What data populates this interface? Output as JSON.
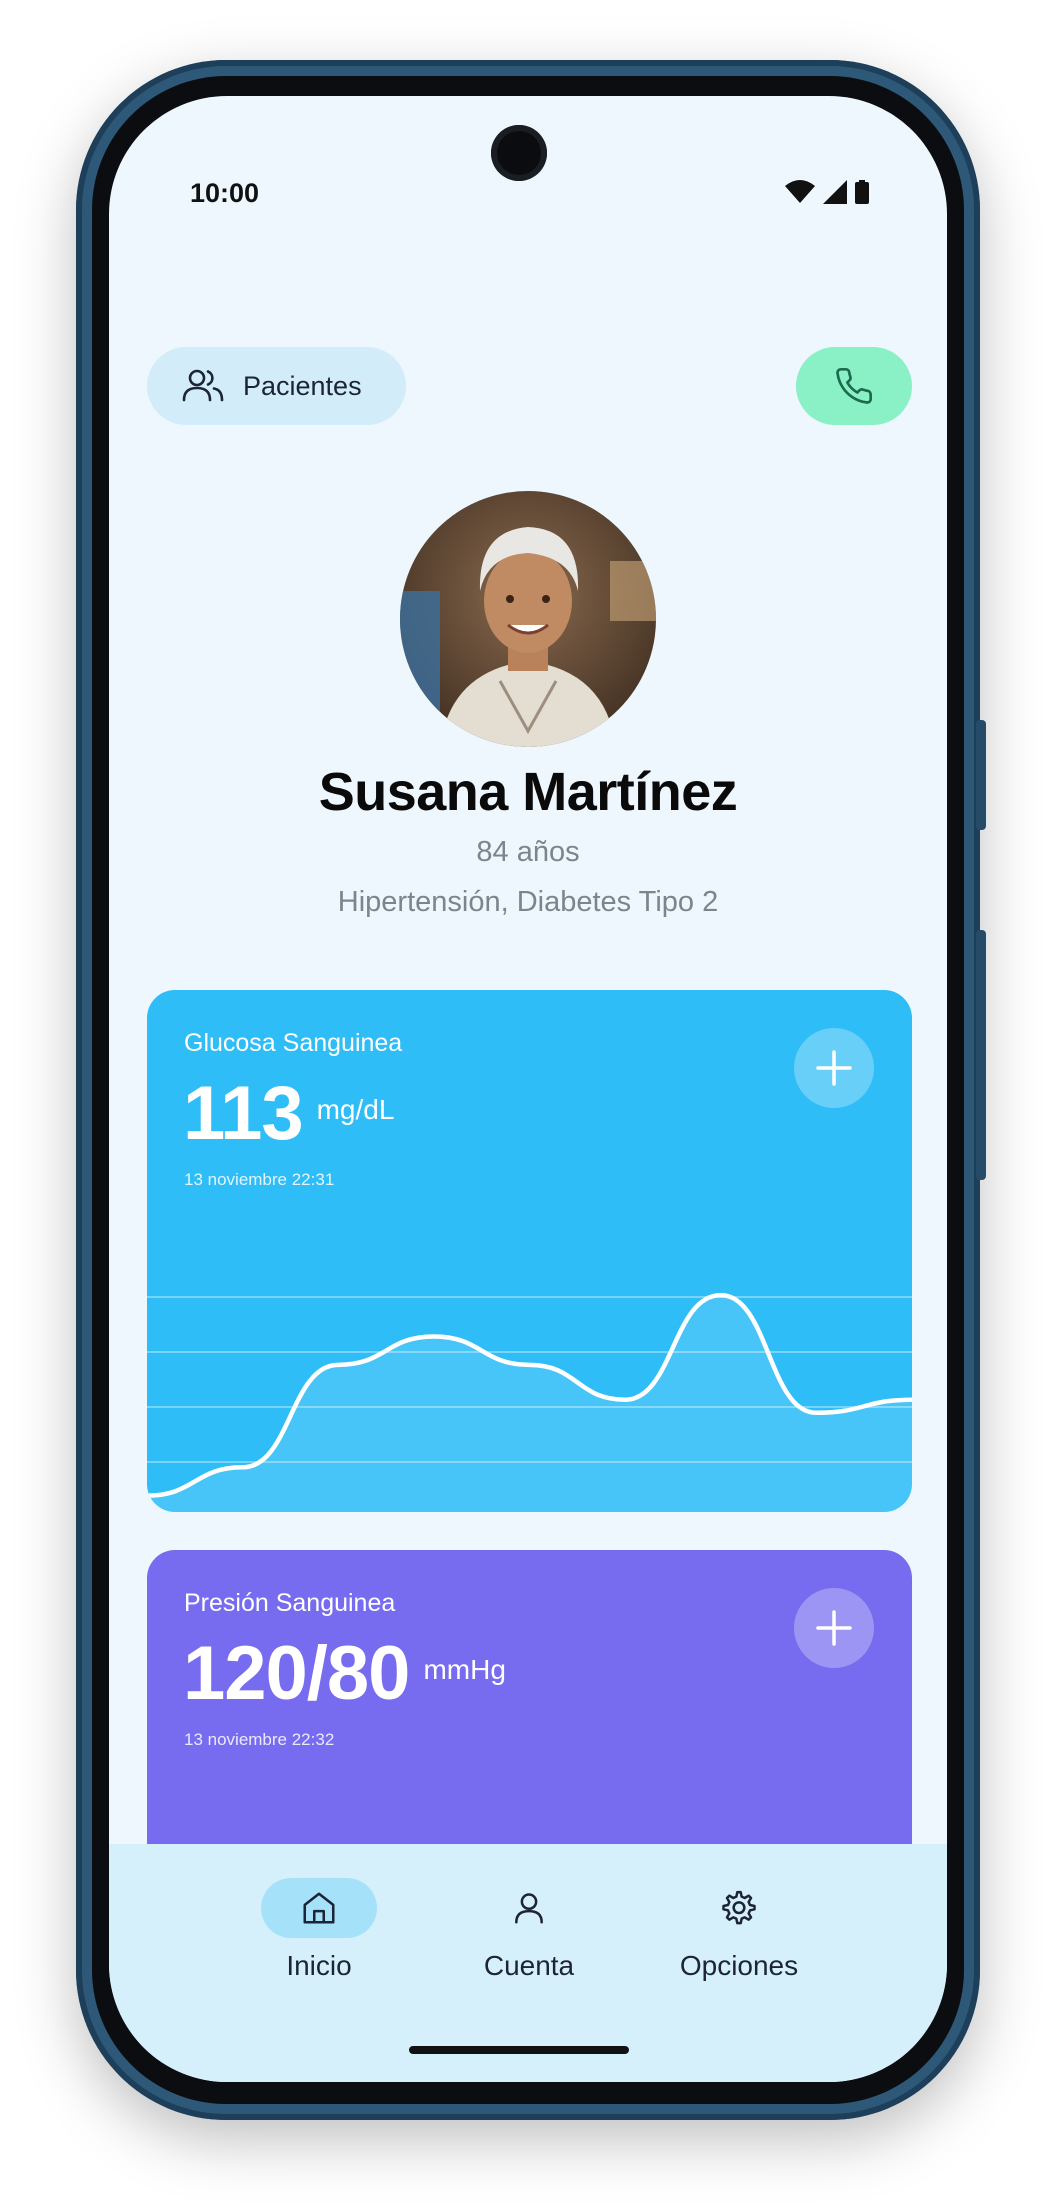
{
  "status_bar": {
    "time": "10:00",
    "icons": [
      "wifi-icon",
      "signal-icon",
      "battery-icon"
    ]
  },
  "header": {
    "patients_button_label": "Pacientes",
    "patients_icon": "users-icon",
    "call_icon": "phone-icon"
  },
  "patient": {
    "name": "Susana Martínez",
    "age": "84 años",
    "conditions": "Hipertensión, Diabetes Tipo 2"
  },
  "cards": {
    "glucose": {
      "title": "Glucosa Sanguinea",
      "value": "113",
      "unit": "mg/dL",
      "timestamp": "13 noviembre 22:31",
      "color": "#2fbdf7",
      "trend": [
        0.02,
        0.15,
        0.62,
        0.75,
        0.62,
        0.46,
        0.94,
        0.4,
        0.46
      ]
    },
    "pressure": {
      "title": "Presión Sanguinea",
      "value": "120/80",
      "unit": "mmHg",
      "timestamp": "13 noviembre 22:32",
      "color": "#776cef"
    }
  },
  "bottom_nav": {
    "items": [
      {
        "label": "Inicio",
        "icon": "home-icon",
        "active": true
      },
      {
        "label": "Cuenta",
        "icon": "user-icon",
        "active": false
      },
      {
        "label": "Opciones",
        "icon": "gear-icon",
        "active": false
      }
    ]
  },
  "colors": {
    "background": "#eef7fd",
    "call_button": "#8af0c6",
    "nav_background": "#d6f0fb",
    "nav_active": "#a6e1fa"
  }
}
